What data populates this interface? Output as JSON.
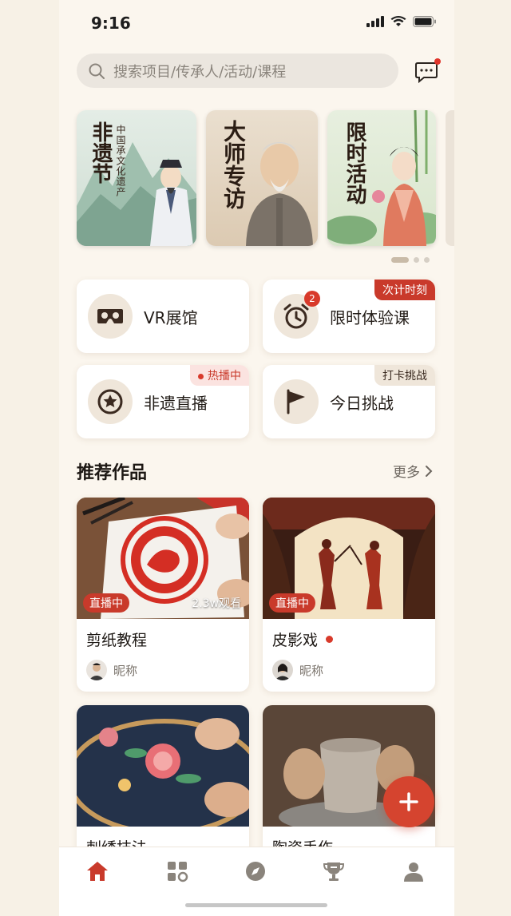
{
  "status_bar": {
    "time": "9:16"
  },
  "search": {
    "placeholder": "搜索项目/传承人/活动/课程"
  },
  "banners": [
    {
      "title": "非遗节",
      "subtitle": "中国承文化遗产"
    },
    {
      "title": "大师专访"
    },
    {
      "title": "限时活动"
    }
  ],
  "features": [
    {
      "label": "VR展馆",
      "icon": "vr-headset-icon"
    },
    {
      "label": "限时体验课",
      "icon": "alarm-clock-icon",
      "badge": "2",
      "tag": "次计时刻"
    },
    {
      "label": "非遗直播",
      "icon": "star-icon",
      "tag": "热播中"
    },
    {
      "label": "今日挑战",
      "icon": "flag-icon",
      "tag": "打卡挑战"
    }
  ],
  "section": {
    "title": "推荐作品",
    "more": "更多"
  },
  "works": [
    {
      "title": "剪纸教程",
      "live": "直播中",
      "views": "2.3w观看",
      "author": "昵称"
    },
    {
      "title": "皮影戏",
      "live": "直播中",
      "author": "昵称"
    },
    {
      "title": "刺绣技法"
    },
    {
      "title": "陶瓷手作"
    }
  ],
  "tabs": [
    "home-icon",
    "category-icon",
    "compass-icon",
    "trophy-icon",
    "profile-icon"
  ],
  "colors": {
    "accent": "#c93a2b",
    "background": "#fbf6ee"
  }
}
